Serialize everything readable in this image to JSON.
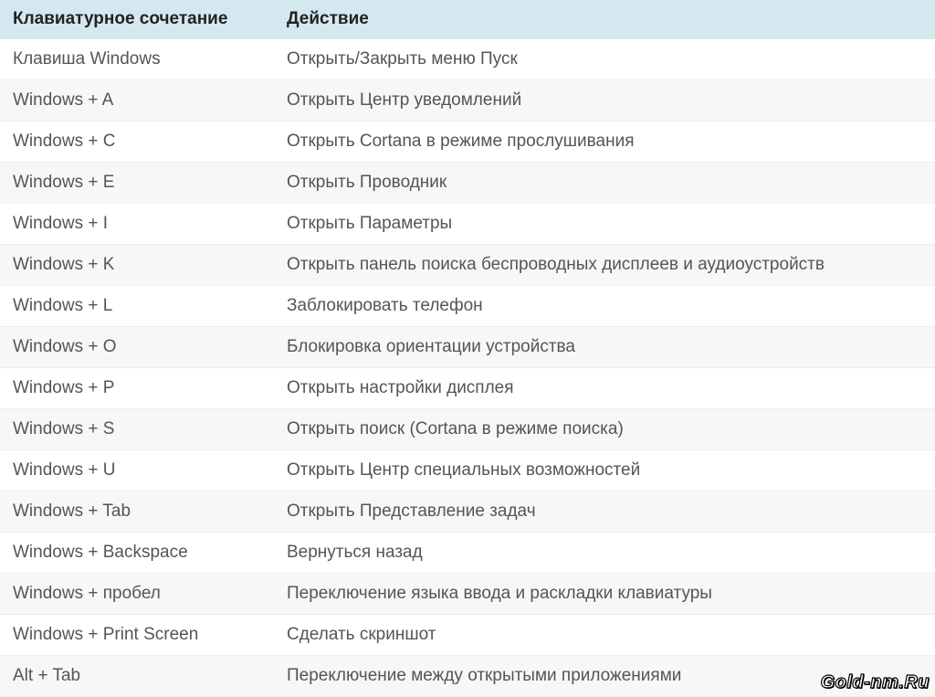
{
  "table": {
    "headers": {
      "shortcut": "Клавиатурное сочетание",
      "action": "Действие"
    },
    "rows": [
      {
        "shortcut": "Клавиша Windows",
        "action": "Открыть/Закрыть меню Пуск"
      },
      {
        "shortcut": "Windows + A",
        "action": "Открыть Центр уведомлений"
      },
      {
        "shortcut": "Windows + C",
        "action": "Открыть Cortana в режиме прослушивания"
      },
      {
        "shortcut": "Windows + E",
        "action": "Открыть Проводник"
      },
      {
        "shortcut": "Windows + I",
        "action": "Открыть Параметры"
      },
      {
        "shortcut": "Windows + K",
        "action": "Открыть панель поиска беспроводных дисплеев и аудиоустройств"
      },
      {
        "shortcut": "Windows + L",
        "action": "Заблокировать телефон"
      },
      {
        "shortcut": "Windows + O",
        "action": "Блокировка ориентации устройства"
      },
      {
        "shortcut": "Windows + P",
        "action": "Открыть настройки дисплея"
      },
      {
        "shortcut": "Windows + S",
        "action": "Открыть поиск (Cortana в режиме поиска)"
      },
      {
        "shortcut": "Windows + U",
        "action": "Открыть Центр специальных возможностей"
      },
      {
        "shortcut": "Windows + Tab",
        "action": "Открыть Представление задач"
      },
      {
        "shortcut": "Windows + Backspace",
        "action": "Вернуться назад"
      },
      {
        "shortcut": "Windows + пробел",
        "action": "Переключение языка ввода и раскладки клавиатуры"
      },
      {
        "shortcut": "Windows + Print Screen",
        "action": "Сделать скриншот"
      },
      {
        "shortcut": "Alt + Tab",
        "action": "Переключение между открытыми приложениями"
      }
    ]
  },
  "watermark": "Gold-nm.Ru"
}
